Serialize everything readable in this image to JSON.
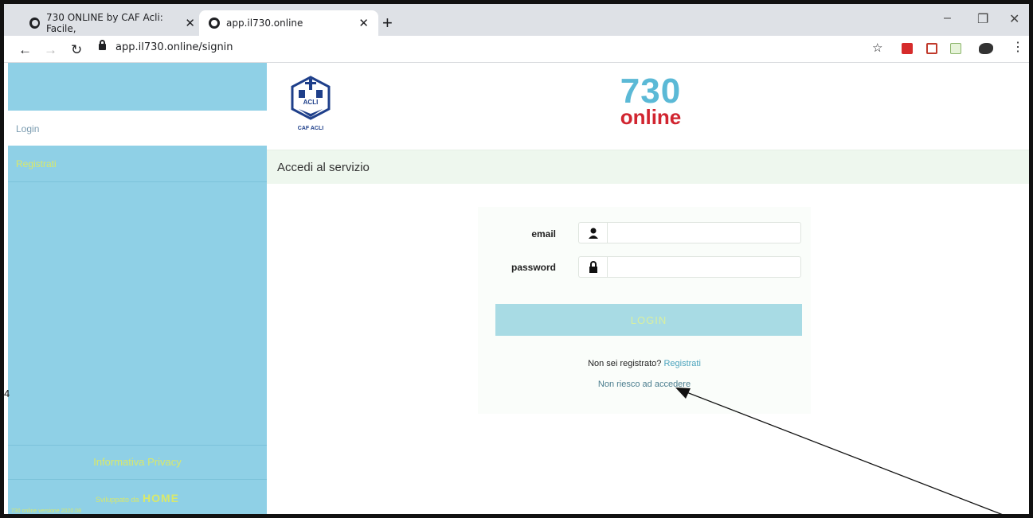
{
  "browser": {
    "tabs": [
      {
        "title": "730 ONLINE by CAF Acli: Facile,",
        "active": false
      },
      {
        "title": "app.il730.online",
        "active": true
      }
    ],
    "new_tab": "+",
    "url": "app.il730.online/signin",
    "window_controls": {
      "minimize": "–",
      "restore": "❐",
      "close": "✕"
    }
  },
  "sidebar": {
    "items": [
      {
        "label": "Login",
        "selected": true
      },
      {
        "label": "Registrati",
        "selected": false
      }
    ],
    "privacy": "Informativa Privacy",
    "footer_small": "Sviluppato da",
    "footer_brand": "HOME",
    "version": "730 online versione 2020.08"
  },
  "header": {
    "caf_logo_text": "ACLI",
    "caf_logo_caption": "CAF ACLI",
    "logo_number": "730",
    "logo_word": "online"
  },
  "page_title": "Accedi al servizio",
  "form": {
    "email_label": "email",
    "email_value": "",
    "password_label": "password",
    "password_value": "",
    "login_button": "LOGIN",
    "register_prompt": "Non sei registrato?",
    "register_link": "Registrati",
    "forgot_link": "Non riesco ad accedere"
  },
  "margin_mark": "4",
  "colors": {
    "sidebar": "#8fd0e6",
    "accent_yellow": "#d9e86a",
    "logo_blue": "#5bb9d6",
    "logo_red": "#d12530",
    "login_button": "#a8dbe4"
  }
}
